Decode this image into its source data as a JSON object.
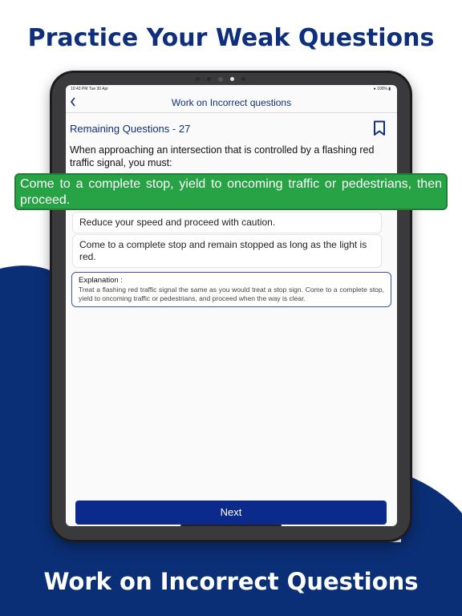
{
  "headline_top": "Practice Your Weak Questions",
  "headline_bottom": "Work on Incorrect Questions",
  "colors": {
    "brand_navy": "#0f2f7d",
    "button_blue": "#0b2a8c",
    "correct_green": "#27a245"
  },
  "statusbar": {
    "time": "10:43 PM   Tue 30 Apr",
    "battery": "100%"
  },
  "nav": {
    "back_icon": "chevron-left-icon",
    "title": "Work on Incorrect questions"
  },
  "quiz": {
    "remaining_label": "Remaining Questions - 27",
    "bookmark_icon": "bookmark-icon",
    "question": "When approaching an intersection that is controlled by a flashing red traffic signal, you must:",
    "correct_answer": "Come to a complete stop, yield to oncoming traffic or pedestrians, then proceed.",
    "options": [
      "Reduce your speed and proceed with caution.",
      "Come to a complete stop and remain stopped as long as the light is red."
    ],
    "explanation_title": "Explanation :",
    "explanation_text": "Treat a flashing red traffic signal the same as you would treat a stop sign. Come to a complete stop, yield to oncoming traffic or pedestrians, and proceed when the way is clear.",
    "next_label": "Next"
  }
}
